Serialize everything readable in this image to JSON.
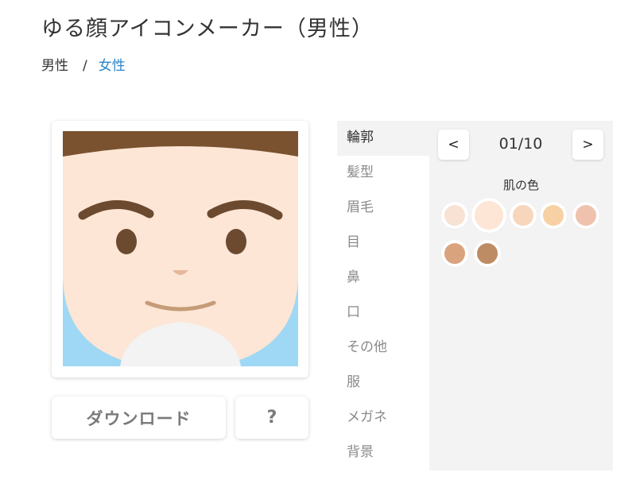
{
  "page": {
    "title": "ゆる顔アイコンメーカー（男性）"
  },
  "breadcrumb": {
    "current": "男性",
    "separator": "/",
    "link": "女性"
  },
  "preview": {
    "colors": {
      "background": "#9fd8f4",
      "hair": "#7a5230",
      "skin": "#fde6d5",
      "shirt": "#f3f3f3",
      "brows": "#6b4a30",
      "eyes": "#6b4a30",
      "nose": "#e6b79a",
      "mouth": "#c59c78"
    }
  },
  "buttons": {
    "download": "ダウンロード",
    "help": "?"
  },
  "parts": [
    {
      "label": "輪郭",
      "active": true
    },
    {
      "label": "髪型",
      "active": false
    },
    {
      "label": "眉毛",
      "active": false
    },
    {
      "label": "目",
      "active": false
    },
    {
      "label": "鼻",
      "active": false
    },
    {
      "label": "口",
      "active": false
    },
    {
      "label": "その他",
      "active": false
    },
    {
      "label": "服",
      "active": false
    },
    {
      "label": "メガネ",
      "active": false
    },
    {
      "label": "背景",
      "active": false
    }
  ],
  "pager": {
    "prev": "<",
    "next": ">",
    "counter": "01/10"
  },
  "skin_section": {
    "label": "肌の色",
    "swatches": [
      {
        "color": "#f7e2d4",
        "selected": false
      },
      {
        "color": "#fde6d5",
        "selected": true
      },
      {
        "color": "#f8d6bc",
        "selected": false
      },
      {
        "color": "#f7d1a4",
        "selected": false
      },
      {
        "color": "#efc2ae",
        "selected": false
      },
      {
        "color": "#d9a37e",
        "selected": false
      },
      {
        "color": "#bd8c64",
        "selected": false
      }
    ]
  }
}
